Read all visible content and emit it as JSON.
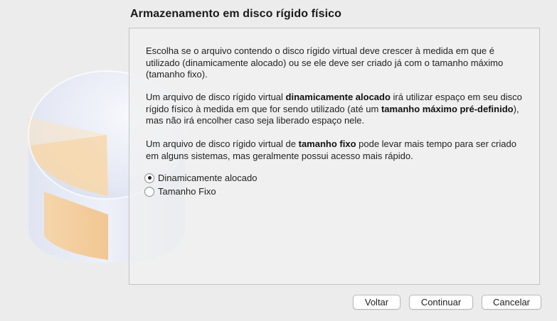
{
  "page": {
    "title": "Armazenamento em disco rígido físico"
  },
  "content": {
    "paragraph1": "Escolha se o arquivo contendo o disco rígido virtual deve crescer à medida em que é utilizado (dinamicamente alocado) ou se ele deve ser criado já com o tamanho máximo (tamanho fixo).",
    "paragraph2": {
      "part1": "Um arquivo de disco rígido virtual ",
      "bold1": "dinamicamente alocado",
      "part2": " irá utilizar espaço em seu disco rígido físico à medida em que for sendo utilizado (até um ",
      "bold2": "tamanho máximo pré-definido",
      "part3": "), mas não irá encolher caso seja liberado espaço nele."
    },
    "paragraph3": {
      "part1": "Um arquivo de disco rígido virtual de ",
      "bold1": "tamanho fixo",
      "part2": " pode levar mais tempo para ser criado em alguns sistemas, mas geralmente possui acesso mais rápido."
    }
  },
  "options": [
    {
      "label": "Dinamicamente alocado",
      "selected": true
    },
    {
      "label": "Tamanho Fixo",
      "selected": false
    }
  ],
  "buttons": {
    "back": "Voltar",
    "continue": "Continuar",
    "cancel": "Cancelar"
  },
  "art": {
    "icon": "hard-disk-pie-icon",
    "colors": {
      "disk_top": "#e8ecf6",
      "disk_side": "#cfd6ea",
      "slice": "#f6d7a8",
      "slice_side": "#f2c48a"
    }
  }
}
